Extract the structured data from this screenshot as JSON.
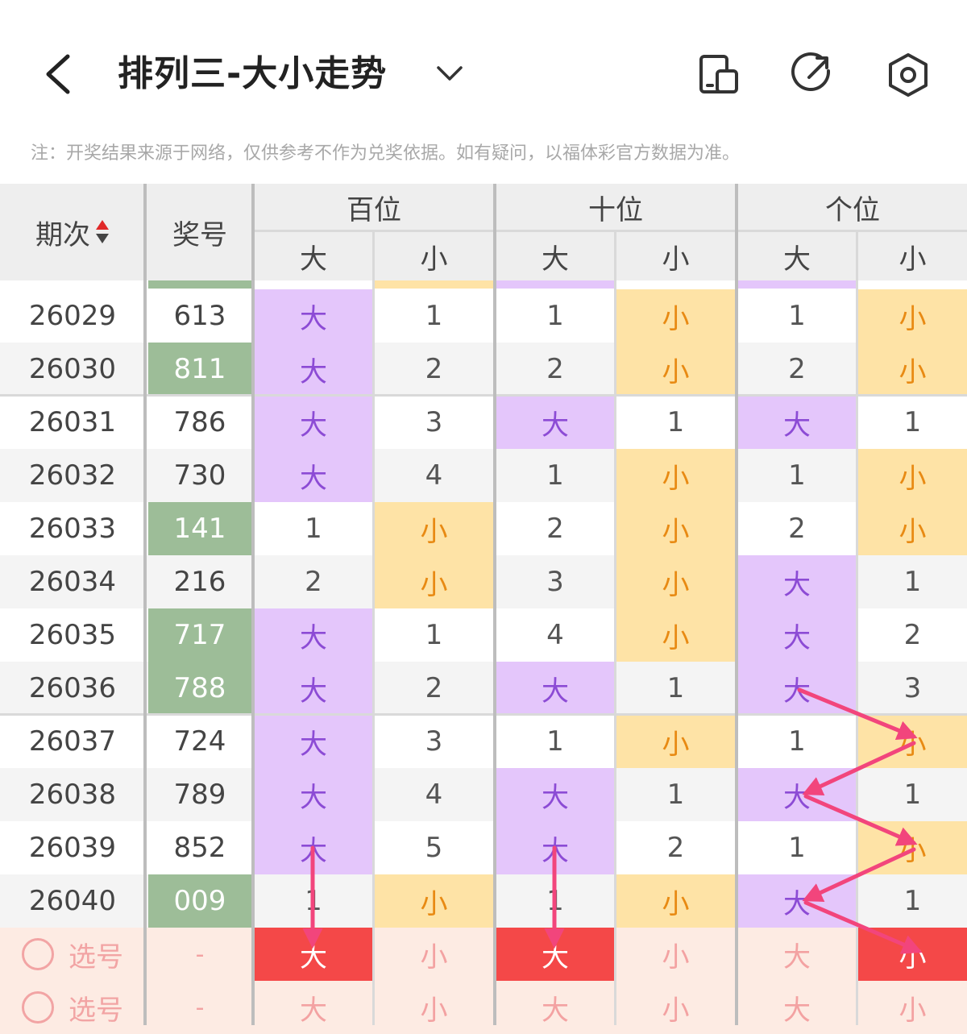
{
  "header": {
    "title": "排列三-大小走势",
    "icons": [
      "back-chevron-icon",
      "dropdown-chevron-icon",
      "device-mode-icon",
      "share-icon",
      "settings-icon"
    ]
  },
  "note": "注：开奖结果来源于网络，仅供参考不作为兑奖依据。如有疑问，以福体彩官方数据为准。",
  "columns": {
    "issue": "期次",
    "number": "奖号",
    "groups": [
      {
        "label": "百位",
        "big": "大",
        "small": "小"
      },
      {
        "label": "十位",
        "big": "大",
        "small": "小"
      },
      {
        "label": "个位",
        "big": "大",
        "small": "小"
      }
    ]
  },
  "rows": [
    {
      "issue": "26029",
      "number": "613",
      "hl": false,
      "cells": [
        "大",
        "1",
        "1",
        "小",
        "1",
        "小"
      ]
    },
    {
      "issue": "26030",
      "number": "811",
      "hl": true,
      "cells": [
        "大",
        "2",
        "2",
        "小",
        "2",
        "小"
      ]
    },
    {
      "issue": "26031",
      "number": "786",
      "hl": false,
      "cells": [
        "大",
        "3",
        "大",
        "1",
        "大",
        "1"
      ]
    },
    {
      "issue": "26032",
      "number": "730",
      "hl": false,
      "cells": [
        "大",
        "4",
        "1",
        "小",
        "1",
        "小"
      ]
    },
    {
      "issue": "26033",
      "number": "141",
      "hl": true,
      "cells": [
        "1",
        "小",
        "2",
        "小",
        "2",
        "小"
      ]
    },
    {
      "issue": "26034",
      "number": "216",
      "hl": false,
      "cells": [
        "2",
        "小",
        "3",
        "小",
        "大",
        "1"
      ]
    },
    {
      "issue": "26035",
      "number": "717",
      "hl": true,
      "cells": [
        "大",
        "1",
        "4",
        "小",
        "大",
        "2"
      ]
    },
    {
      "issue": "26036",
      "number": "788",
      "hl": true,
      "cells": [
        "大",
        "2",
        "大",
        "1",
        "大",
        "3"
      ]
    },
    {
      "issue": "26037",
      "number": "724",
      "hl": false,
      "cells": [
        "大",
        "3",
        "1",
        "小",
        "1",
        "小"
      ]
    },
    {
      "issue": "26038",
      "number": "789",
      "hl": false,
      "cells": [
        "大",
        "4",
        "大",
        "1",
        "大",
        "1"
      ]
    },
    {
      "issue": "26039",
      "number": "852",
      "hl": false,
      "cells": [
        "大",
        "5",
        "大",
        "2",
        "1",
        "小"
      ]
    },
    {
      "issue": "26040",
      "number": "009",
      "hl": true,
      "cells": [
        "1",
        "小",
        "1",
        "小",
        "大",
        "1"
      ]
    }
  ],
  "pick_rows": [
    {
      "label": "选号",
      "number": "-",
      "cells": [
        "大",
        "小",
        "大",
        "小",
        "大",
        "小"
      ],
      "selected": [
        0,
        2,
        5
      ]
    },
    {
      "label": "选号",
      "number": "-",
      "cells": [
        "大",
        "小",
        "大",
        "小",
        "大",
        "小"
      ],
      "selected": []
    }
  ],
  "colors": {
    "big_bg": "#e4c6fb",
    "big_text": "#8c4bd5",
    "small_bg": "#fee3a6",
    "small_text": "#e88a13",
    "number_highlight": "#9dbd98",
    "pick_selected": "#f44848",
    "annotation_arrow": "#f2457c"
  }
}
